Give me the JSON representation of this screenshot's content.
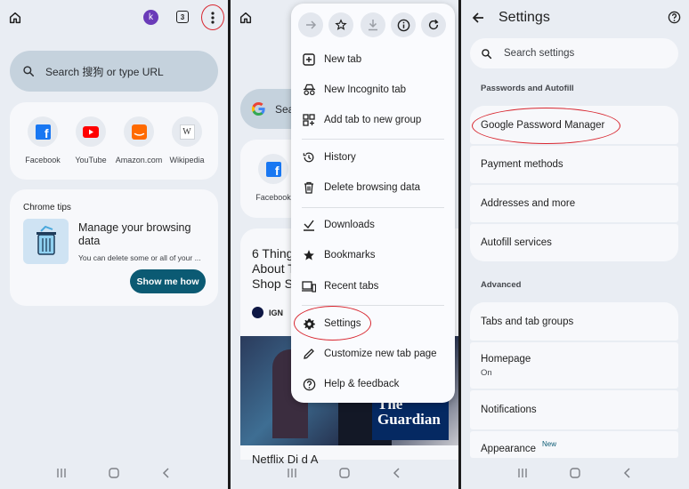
{
  "panel1": {
    "avatar_letter": "k",
    "tab_count": "3",
    "search_placeholder": "Search 搜狗 or type URL",
    "shortcuts": [
      {
        "label": "Facebook",
        "icon": "facebook-icon",
        "color": "#1877f2"
      },
      {
        "label": "YouTube",
        "icon": "youtube-icon",
        "color": "#ff0000"
      },
      {
        "label": "Amazon.com",
        "icon": "amazon-icon",
        "color": "#ff6a00"
      },
      {
        "label": "Wikipedia",
        "icon": "wikipedia-icon",
        "color": "#ffffff"
      }
    ],
    "tips": {
      "header": "Chrome tips",
      "title": "Manage your browsing data",
      "body": "You can delete some or all of your ...",
      "button": "Show me how"
    }
  },
  "panel2": {
    "search_partial": "Sea",
    "shortcut_label": "Facebook",
    "article": {
      "title_lines": [
        "6 Thing",
        "About T",
        "Shop S"
      ],
      "source": "IGN",
      "image_brand_line1": "The",
      "image_brand_line2": "Guardian",
      "bottom_text": "Netflix Di    d A"
    },
    "menu": {
      "toolbar": [
        "forward-icon",
        "star-icon",
        "download-icon",
        "info-icon",
        "refresh-icon"
      ],
      "items": [
        {
          "label": "New tab",
          "icon": "new-tab-icon"
        },
        {
          "label": "New Incognito tab",
          "icon": "incognito-icon"
        },
        {
          "label": "Add tab to new group",
          "icon": "tab-group-icon"
        },
        {
          "label": "History",
          "icon": "history-icon"
        },
        {
          "label": "Delete browsing data",
          "icon": "trash-icon"
        },
        {
          "label": "Downloads",
          "icon": "downloads-icon"
        },
        {
          "label": "Bookmarks",
          "icon": "bookmark-star-icon"
        },
        {
          "label": "Recent tabs",
          "icon": "recent-tabs-icon"
        },
        {
          "label": "Settings",
          "icon": "gear-icon"
        },
        {
          "label": "Customize new tab page",
          "icon": "pencil-icon"
        },
        {
          "label": "Help & feedback",
          "icon": "help-icon"
        }
      ]
    }
  },
  "panel3": {
    "title": "Settings",
    "search_placeholder": "Search settings",
    "section1": "Passwords and Autofill",
    "group1": [
      "Google Password Manager",
      "Payment methods",
      "Addresses and more",
      "Autofill services"
    ],
    "section2": "Advanced",
    "group2": [
      {
        "label": "Tabs and tab groups",
        "sub": ""
      },
      {
        "label": "Homepage",
        "sub": "On"
      },
      {
        "label": "Notifications",
        "sub": ""
      },
      {
        "label": "Appearance",
        "sub": ""
      }
    ],
    "new_badge": "New"
  },
  "colors": {
    "highlight_ring": "#d8262f",
    "accent_button": "#0b5a73",
    "avatar": "#6a3bb8"
  }
}
